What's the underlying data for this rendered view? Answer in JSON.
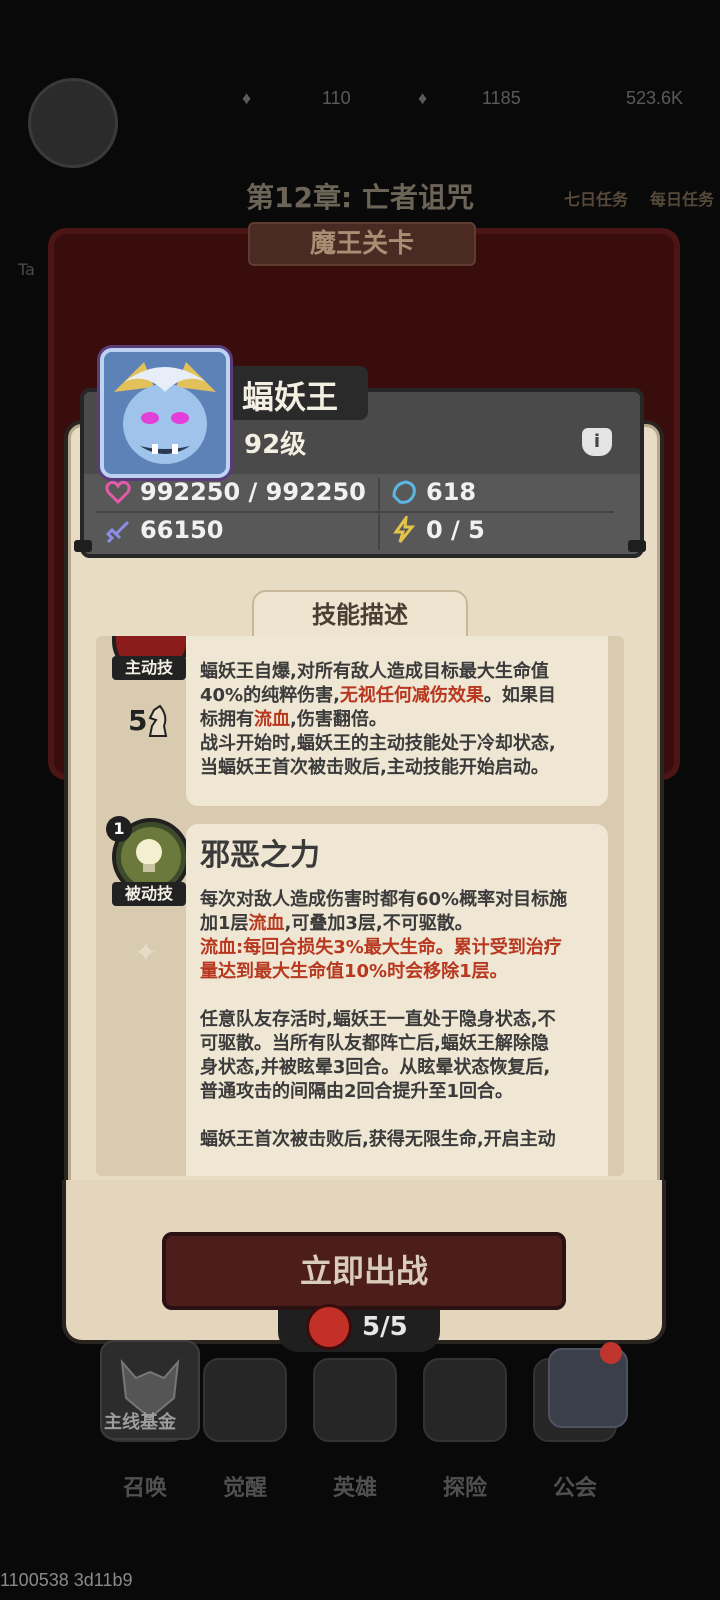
{
  "top_bar": {
    "currency_1": "110",
    "currency_2": "1185",
    "currency_3": "523.6K"
  },
  "background": {
    "chapter_title": "第12章: 亡者诅咒",
    "stage_banner": "魔王关卡",
    "right_labels": [
      "七日任务",
      "每日任务"
    ],
    "left_label": "Ta"
  },
  "boss": {
    "name": "蝠妖王",
    "level": "92级",
    "hp": "992250 / 992250",
    "defense": "618",
    "attack": "66150",
    "energy": "0 / 5",
    "info_icon": "i"
  },
  "skills_section": {
    "tab_label": "技能描述",
    "active_skill": {
      "badge": "主动技",
      "cost": "5",
      "line1": "蝠妖王自爆,对所有敌人造成目标最大生命值",
      "line2a": "40%的纯粹伤害,",
      "line2b": "无视任何减伤效果",
      "line2c": "。如果目",
      "line3a": "标拥有",
      "line3b": "流血",
      "line3c": ",伤害翻倍。",
      "line4": "战斗开始时,蝠妖王的主动技能处于冷却状态,",
      "line5": "当蝠妖王首次被击败后,主动技能开始启动。"
    },
    "passive_skill": {
      "level": "1",
      "badge": "被动技",
      "title": "邪恶之力",
      "p1a": "每次对敌人造成伤害时都有60%概率对目标施",
      "p1b": "加1层",
      "p1c": "流血",
      "p1d": ",可叠加3层,不可驱散。",
      "p2": "流血:每回合损失3%最大生命。累计受到治疗",
      "p3": "量达到最大生命值10%时会移除1层。",
      "p4": "任意队友存活时,蝠妖王一直处于隐身状态,不",
      "p5": "可驱散。当所有队友都阵亡后,蝠妖王解除隐",
      "p6": "身状态,并被眩晕3回合。从眩晕状态恢复后,",
      "p7": "普通攻击的间隔由2回合提升至1回合。",
      "p8": "蝠妖王首次被击败后,获得无限生命,开启主动"
    }
  },
  "battle_button": "立即出战",
  "stamina": "5/5",
  "bottom_nav": {
    "fund_label": "主线基金",
    "items": [
      "召唤",
      "觉醒",
      "英雄",
      "探险",
      "公会"
    ]
  },
  "footer_id": "1100538 3d11b9",
  "colors": {
    "highlight": "#b8371f",
    "panel": "#e8dcc4",
    "header": "#585858"
  }
}
